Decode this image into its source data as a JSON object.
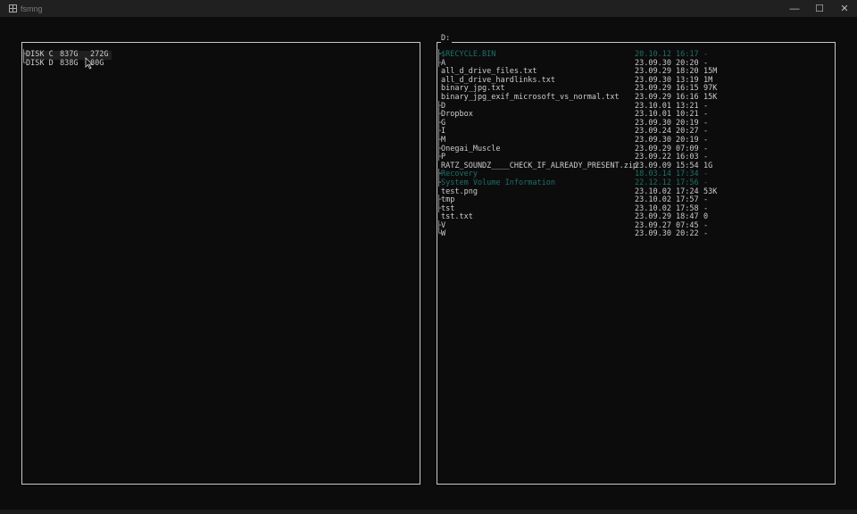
{
  "window": {
    "title": "fsmng",
    "minimize": "—",
    "maximize": "☐",
    "close": "✕"
  },
  "left_panel": {
    "disks": [
      {
        "branch": "├",
        "name": "DISK C",
        "total": "837G",
        "free": "272G"
      },
      {
        "branch": "└",
        "name": "DISK D",
        "total": "838G",
        "free": "80G"
      }
    ]
  },
  "right_panel": {
    "title": "D:",
    "entries": [
      {
        "branch": "├",
        "name": "$RECYCLE.BIN",
        "date": "20.10.12 16:17",
        "size": "-",
        "dim": true
      },
      {
        "branch": "├",
        "name": "A",
        "date": "23.09.30 20:20",
        "size": "-",
        "dim": false
      },
      {
        "branch": "",
        "name": "all_d_drive_files.txt",
        "date": "23.09.29 18:20",
        "size": "15M",
        "dim": false
      },
      {
        "branch": "",
        "name": "all_d_drive_hardlinks.txt",
        "date": "23.09.30 13:19",
        "size": "1M",
        "dim": false
      },
      {
        "branch": "",
        "name": "binary_jpg.txt",
        "date": "23.09.29 16:15",
        "size": "97K",
        "dim": false
      },
      {
        "branch": "",
        "name": "binary_jpg_exif_microsoft_vs_normal.txt",
        "date": "23.09.29 16:16",
        "size": "15K",
        "dim": false
      },
      {
        "branch": "├",
        "name": "D",
        "date": "23.10.01 13:21",
        "size": "-",
        "dim": false
      },
      {
        "branch": "├",
        "name": "Dropbox",
        "date": "23.10.01 10:21",
        "size": "-",
        "dim": false
      },
      {
        "branch": "├",
        "name": "G",
        "date": "23.09.30 20:19",
        "size": "-",
        "dim": false
      },
      {
        "branch": "├",
        "name": "I",
        "date": "23.09.24 20:27",
        "size": "-",
        "dim": false
      },
      {
        "branch": "├",
        "name": "M",
        "date": "23.09.30 20:19",
        "size": "-",
        "dim": false
      },
      {
        "branch": "├",
        "name": "Onegai_Muscle",
        "date": "23.09.29 07:09",
        "size": "-",
        "dim": false
      },
      {
        "branch": "├",
        "name": "P",
        "date": "23.09.22 16:03",
        "size": "-",
        "dim": false
      },
      {
        "branch": "",
        "name": "RATZ_SOUNDZ____CHECK_IF_ALREADY_PRESENT.zip",
        "date": "23.09.09 15:54",
        "size": "1G",
        "dim": false
      },
      {
        "branch": "├",
        "name": "Recovery",
        "date": "18.03.14 17:34",
        "size": "-",
        "dim": true
      },
      {
        "branch": "├",
        "name": "System Volume Information",
        "date": "22.12.12 17:56",
        "size": "-",
        "dim": true
      },
      {
        "branch": "",
        "name": "test.png",
        "date": "23.10.02 17:24",
        "size": "53K",
        "dim": false
      },
      {
        "branch": "├",
        "name": "tmp",
        "date": "23.10.02 17:57",
        "size": "-",
        "dim": false
      },
      {
        "branch": "├",
        "name": "tst",
        "date": "23.10.02 17:58",
        "size": "-",
        "dim": false
      },
      {
        "branch": "",
        "name": "tst.txt",
        "date": "23.09.29 18:47",
        "size": "0",
        "dim": false
      },
      {
        "branch": "├",
        "name": "V",
        "date": "23.09.27 07:45",
        "size": "-",
        "dim": false
      },
      {
        "branch": "└",
        "name": "W",
        "date": "23.09.30 20:22",
        "size": "-",
        "dim": false
      }
    ]
  },
  "colors": {
    "background": "#0c0c0c",
    "text": "#cccccc",
    "dim_entry": "#1f6f6a",
    "border": "#c8c8c8"
  }
}
